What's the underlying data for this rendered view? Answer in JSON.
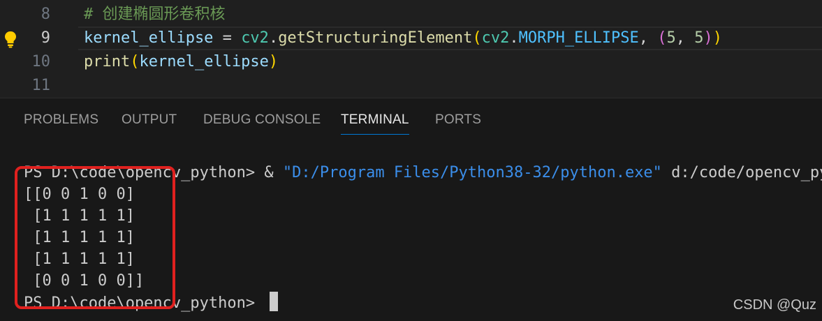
{
  "editor": {
    "lines": [
      {
        "num": "8",
        "text": "# 创建椭圆形卷积核"
      },
      {
        "num": "9",
        "tokens": [
          "kernel_ellipse",
          " = ",
          "cv2",
          ".",
          "getStructuringElement",
          "(",
          "cv2",
          ".",
          "MORPH_ELLIPSE",
          ", ",
          "(",
          "5",
          ", ",
          "5",
          ")",
          ")"
        ]
      },
      {
        "num": "10",
        "tokens": [
          "print",
          "(",
          "kernel_ellipse",
          ")"
        ]
      },
      {
        "num": "11",
        "text": ""
      }
    ],
    "lightbulb_icon": "lightbulb-icon"
  },
  "panel": {
    "tabs": [
      "PROBLEMS",
      "OUTPUT",
      "DEBUG CONSOLE",
      "TERMINAL",
      "PORTS"
    ],
    "active_tab": "TERMINAL"
  },
  "terminal": {
    "command_prompt": "PS D:\\code\\opencv_python> ",
    "command_op": "& ",
    "command_exe": "\"D:/Program Files/Python38-32/python.exe\"",
    "command_arg": " d:/code/opencv_pyt",
    "output": [
      "[[0 0 1 0 0]",
      " [1 1 1 1 1]",
      " [1 1 1 1 1]",
      " [1 1 1 1 1]",
      " [0 0 1 0 0]]"
    ],
    "final_prompt": "PS D:\\code\\opencv_python> "
  },
  "watermark": "CSDN @Quz",
  "colors": {
    "highlight": "#e0211f",
    "accent": "#0078d4"
  }
}
